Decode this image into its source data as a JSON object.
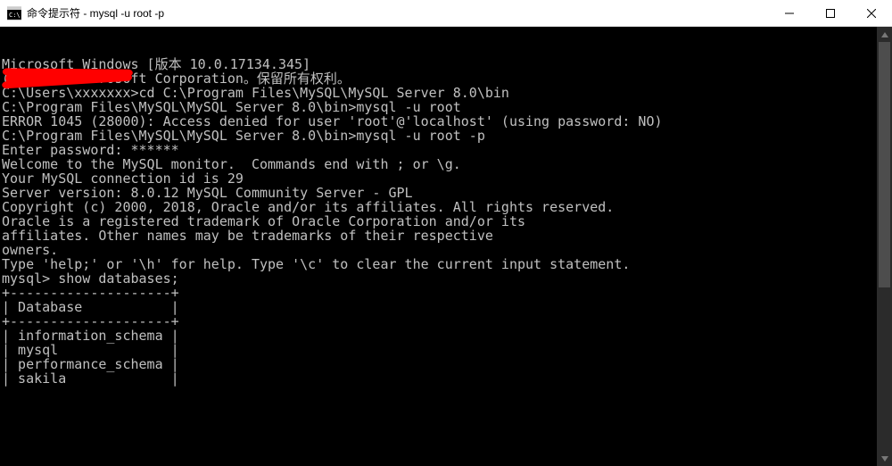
{
  "titlebar": {
    "title": "命令提示符 - mysql  -u root -p"
  },
  "terminal": {
    "lines": [
      "Microsoft Windows [版本 10.0.17134.345]",
      "(c) 2018 Microsoft Corporation。保留所有权利。",
      "",
      "C:\\Users\\xxxxxxx>cd C:\\Program Files\\MySQL\\MySQL Server 8.0\\bin",
      "",
      "C:\\Program Files\\MySQL\\MySQL Server 8.0\\bin>mysql -u root",
      "ERROR 1045 (28000): Access denied for user 'root'@'localhost' (using password: NO)",
      "",
      "C:\\Program Files\\MySQL\\MySQL Server 8.0\\bin>mysql -u root -p",
      "Enter password: ******",
      "Welcome to the MySQL monitor.  Commands end with ; or \\g.",
      "Your MySQL connection id is 29",
      "Server version: 8.0.12 MySQL Community Server - GPL",
      "",
      "Copyright (c) 2000, 2018, Oracle and/or its affiliates. All rights reserved.",
      "",
      "Oracle is a registered trademark of Oracle Corporation and/or its",
      "affiliates. Other names may be trademarks of their respective",
      "owners.",
      "",
      "Type 'help;' or '\\h' for help. Type '\\c' to clear the current input statement.",
      "",
      "mysql> show databases;",
      "+--------------------+",
      "| Database           |",
      "+--------------------+",
      "| information_schema |",
      "| mysql              |",
      "| performance_schema |",
      "| sakila             |"
    ],
    "prompt": "mysql>",
    "command": "show databases;",
    "databases": [
      "information_schema",
      "mysql",
      "performance_schema",
      "sakila"
    ]
  }
}
